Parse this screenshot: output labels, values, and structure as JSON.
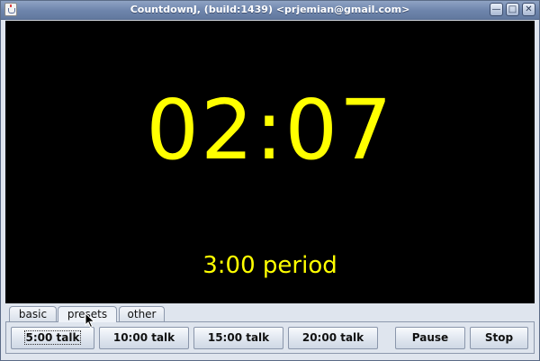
{
  "window": {
    "title": "CountdownJ, (build:1439) <prjemian@gmail.com>"
  },
  "display": {
    "time": "02:07",
    "period": "3:00 period",
    "background_color": "#000000",
    "text_color": "#ffff00"
  },
  "tabs": [
    {
      "label": "basic",
      "selected": false
    },
    {
      "label": "presets",
      "selected": true
    },
    {
      "label": "other",
      "selected": false
    }
  ],
  "presets": {
    "buttons": [
      "5:00 talk",
      "10:00 talk",
      "15:00 talk",
      "20:00 talk"
    ],
    "focused": "5:00 talk"
  },
  "controls": {
    "pause_label": "Pause",
    "stop_label": "Stop"
  },
  "icons": {
    "app": "java-cup-icon",
    "minimize": "minimize-icon",
    "maximize": "maximize-icon",
    "close": "close-icon",
    "cursor": "mouse-pointer-icon"
  }
}
